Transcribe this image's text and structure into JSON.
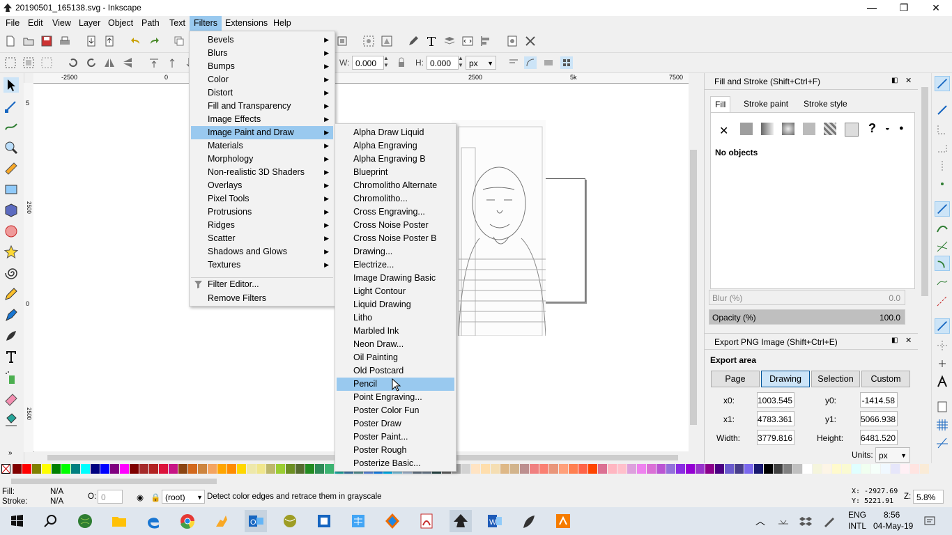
{
  "window": {
    "title": "20190501_165138.svg - Inkscape",
    "minimize": "—",
    "restore": "❐",
    "close": "✕"
  },
  "menubar": [
    "File",
    "Edit",
    "View",
    "Layer",
    "Object",
    "Path",
    "Text",
    "Filters",
    "Extensions",
    "Help"
  ],
  "toolctrl": {
    "w_label": "W:",
    "w_value": "0.000",
    "h_label": "H:",
    "h_value": "0.000",
    "unit": "px"
  },
  "rulers": {
    "top": [
      "-2500",
      "0",
      "2500",
      "5k",
      "7500"
    ],
    "left": [
      "5",
      "2500",
      "0",
      "2500"
    ]
  },
  "filters_menu": {
    "items": [
      "Bevels",
      "Blurs",
      "Bumps",
      "Color",
      "Distort",
      "Fill and Transparency",
      "Image Effects",
      "Image Paint and Draw",
      "Materials",
      "Morphology",
      "Non-realistic 3D Shaders",
      "Overlays",
      "Pixel Tools",
      "Protrusions",
      "Ridges",
      "Scatter",
      "Shadows and Glows",
      "Textures"
    ],
    "highlighted": "Image Paint and Draw",
    "filter_editor": "Filter Editor...",
    "remove_filters": "Remove Filters"
  },
  "submenu": {
    "items": [
      "Alpha Draw Liquid",
      "Alpha Engraving",
      "Alpha Engraving B",
      "Blueprint",
      "Chromolitho Alternate",
      "Chromolitho...",
      "Cross Engraving...",
      "Cross Noise Poster",
      "Cross Noise Poster B",
      "Drawing...",
      "Electrize...",
      "Image Drawing Basic",
      "Light Contour",
      "Liquid Drawing",
      "Litho",
      "Marbled Ink",
      "Neon Draw...",
      "Oil Painting",
      "Old Postcard",
      "Pencil",
      "Point Engraving...",
      "Poster Color Fun",
      "Poster Draw",
      "Poster Paint...",
      "Poster Rough",
      "Posterize Basic..."
    ],
    "highlighted": "Pencil"
  },
  "fill_stroke": {
    "title": "Fill and Stroke (Shift+Ctrl+F)",
    "tabs": [
      "Fill",
      "Stroke paint",
      "Stroke style"
    ],
    "no_objects": "No objects",
    "blur_label": "Blur (%)",
    "blur_value": "0.0",
    "opacity_label": "Opacity (%)",
    "opacity_value": "100.0"
  },
  "export": {
    "title": "Export PNG Image (Shift+Ctrl+E)",
    "area_label": "Export area",
    "buttons": [
      "Page",
      "Drawing",
      "Selection",
      "Custom"
    ],
    "active": "Drawing",
    "x0_label": "x0:",
    "x0": "1003.545",
    "y0_label": "y0:",
    "y0": "-1414.58",
    "x1_label": "x1:",
    "x1": "4783.361",
    "y1_label": "y1:",
    "y1": "5066.938",
    "width_label": "Width:",
    "width": "3779.816",
    "height_label": "Height:",
    "height": "6481.520",
    "units_label": "Units:",
    "units": "px"
  },
  "status": {
    "fill_label": "Fill:",
    "fill_value": "N/A",
    "stroke_label": "Stroke:",
    "stroke_value": "N/A",
    "o_label": "O:",
    "o_value": "0",
    "layer": "(root)",
    "message": "Detect color edges and retrace them in grayscale",
    "x_coord": "X: -2927.69",
    "y_coord": "Y:  5221.91",
    "z_label": "Z:",
    "zoom": "5.8%"
  },
  "taskbar": {
    "lang1": "ENG",
    "lang2": "INTL",
    "time": "8:56",
    "date": "04-May-19"
  },
  "colors": {
    "highlight": "#99c9ef",
    "active_btn": "#cce4f7",
    "swatches": [
      "#800000",
      "#ff0000",
      "#808000",
      "#ffff00",
      "#008000",
      "#00ff00",
      "#008080",
      "#00ffff",
      "#000080",
      "#0000ff",
      "#800080",
      "#ff00ff",
      "#7f0000",
      "#a52a2a",
      "#b22222",
      "#dc143c",
      "#c71585",
      "#8b4513",
      "#d2691e",
      "#cd853f",
      "#f4a460",
      "#ffa500",
      "#ff8c00",
      "#ffd700",
      "#eee8aa",
      "#f0e68c",
      "#bdb76b",
      "#9acd32",
      "#6b8e23",
      "#556b2f",
      "#228b22",
      "#2e8b57",
      "#3cb371",
      "#20b2aa",
      "#4682b4",
      "#5f9ea0",
      "#6495ed",
      "#1e90ff",
      "#00bfff",
      "#87ceeb",
      "#b0c4de",
      "#708090",
      "#778899",
      "#2f4f4f",
      "#696969",
      "#a9a9a9",
      "#d3d3d3",
      "#ffe4c4",
      "#ffdead",
      "#f5deb3",
      "#deb887",
      "#d2b48c",
      "#bc8f8f",
      "#f08080",
      "#fa8072",
      "#e9967a",
      "#ffa07a",
      "#ff7f50",
      "#ff6347",
      "#ff4500",
      "#db7093",
      "#ffb6c1",
      "#ffc0cb",
      "#dda0dd",
      "#ee82ee",
      "#da70d6",
      "#ba55d3",
      "#9370db",
      "#8a2be2",
      "#9400d3",
      "#9932cc",
      "#8b008b",
      "#4b0082",
      "#6a5acd",
      "#483d8b",
      "#7b68ee",
      "#191970",
      "#000000",
      "#404040",
      "#808080",
      "#c0c0c0",
      "#ffffff",
      "#f5f5dc",
      "#fdf5e6",
      "#fffacd",
      "#fafad2",
      "#e0ffff",
      "#f0fff0",
      "#f5fffa",
      "#f0f8ff",
      "#e6e6fa",
      "#fff0f5",
      "#ffe4e1",
      "#faebd7"
    ]
  }
}
